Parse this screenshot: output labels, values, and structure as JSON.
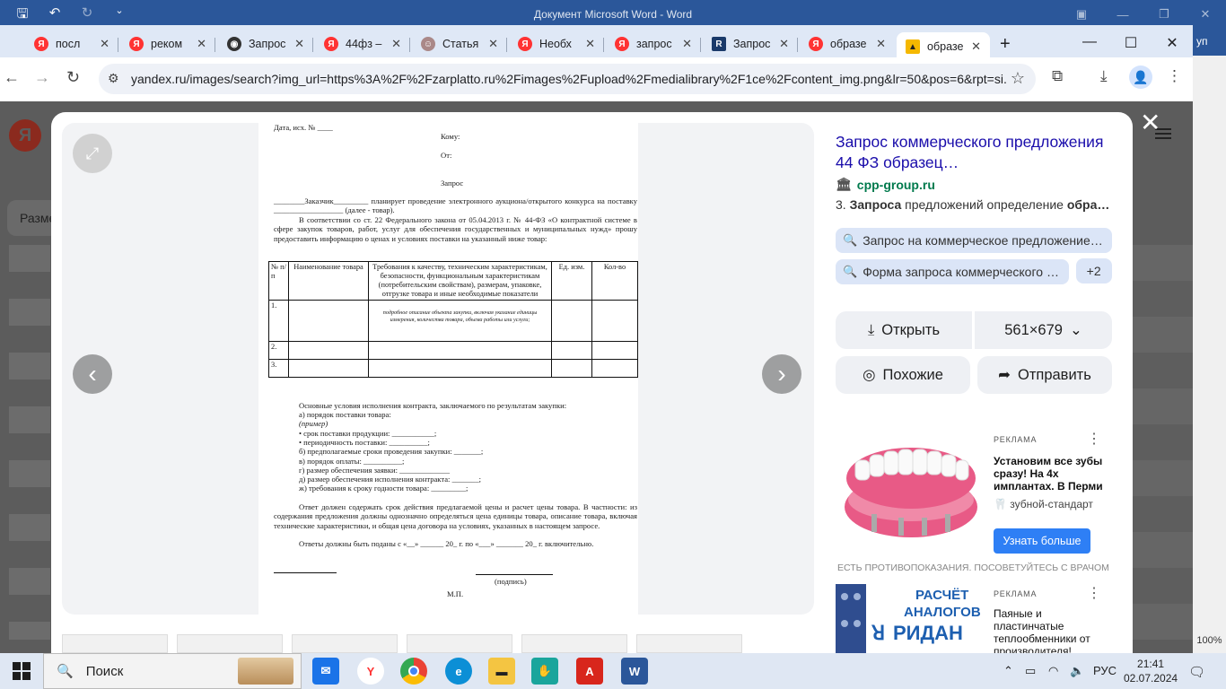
{
  "word": {
    "title": "Документ Microsoft Word - Word",
    "edge_label": "уп"
  },
  "browser": {
    "tabs": [
      {
        "label": "посл",
        "favicon": "yandex-icon",
        "color": "#f33"
      },
      {
        "label": "реком",
        "favicon": "yandex-icon",
        "color": "#f33"
      },
      {
        "label": "Запрос",
        "favicon": "globe-icon",
        "color": "#333"
      },
      {
        "label": "44фз –",
        "favicon": "yandex-icon",
        "color": "#f33"
      },
      {
        "label": "Статья",
        "favicon": "avatar-icon",
        "color": "#a88"
      },
      {
        "label": "Необх",
        "favicon": "yandex-icon",
        "color": "#f33"
      },
      {
        "label": "запрос",
        "favicon": "yandex-icon",
        "color": "#f33"
      },
      {
        "label": "Запрос",
        "favicon": "r-icon",
        "color": "#1a3a6a"
      },
      {
        "label": "образе",
        "favicon": "yandex-icon",
        "color": "#f33"
      },
      {
        "label": "образе",
        "favicon": "image-icon",
        "color": "#f5b800",
        "active": true
      }
    ],
    "url": "yandex.ru/images/search?img_url=https%3A%2F%2Fzarplatto.ru%2Fimages%2Fupload%2Fmedialibrary%2F1ce%2Fcontent_img.png&lr=50&pos=6&rpt=si..."
  },
  "background": {
    "logo": "Я",
    "filter_label": "Разме"
  },
  "document": {
    "date_line": "Дата, исх. № ____",
    "to": "Кому:",
    "from": "От:",
    "heading": "Запрос",
    "p1": "________Заказчик_________ планирует проведение электронного аукциона/открытого конкурса на поставку __________________ (далее - товар).",
    "p2": "В соответствии со ст. 22 Федерального закона от 05.04.2013 г. № 44-ФЗ «О контрактной системе в сфере закупок товаров, работ, услуг для обеспечения государственных и муниципальных нужд» прошу предоставить информацию о ценах и условиях поставки на указанный ниже товар:",
    "table_headers": [
      "№ п/п",
      "Наименование товара",
      "Требования к качеству, техническим характеристикам, безопасности, функциональным характеристикам (потребительским свойствам), размерам, упаковке, отгрузке товара и иные необходимые показатели",
      "Ед. изм.",
      "Кол-во"
    ],
    "table_rows": [
      {
        "n": "1.",
        "desc": "подробное описание объекта закупки, включая указание единицы измерения, количества товара, объема работы или услуги;"
      },
      {
        "n": "2.",
        "desc": ""
      },
      {
        "n": "3.",
        "desc": ""
      }
    ],
    "conditions_title": "Основные условия исполнения контракта, заключаемого по результатам закупки:",
    "conditions": [
      "а) порядок поставки товара:",
      "(пример)",
      "•   срок поставки продукции: ___________;",
      "•   периодичность поставки: __________;",
      "б) предполагаемые сроки проведения закупки: _______;",
      "в) порядок оплаты: __________;",
      "г) размер обеспечения заявки: _____________",
      "д) размер обеспечения исполнения контракта: _______;",
      "ж) требования к сроку годности товара: _________;"
    ],
    "p3": "Ответ должен содержать срок действия предлагаемой цены и расчет цены товара. В частности: из содержания предложения должны однозначно определяться цена единицы товара, описание товара, включая технические характеристики, и общая цена договора на условиях, указанных в настоящем запросе.",
    "p4": "Ответы должны быть поданы с «__» ______ 20_ г. по «___» _______ 20_ г. включительно.",
    "signature": "(подпись)",
    "stamp": "М.П."
  },
  "panel": {
    "title": "Запрос коммерческого предложения 44 ФЗ образец…",
    "source": "cpp-group.ru",
    "snippet_num": "3.",
    "snippet_b1": "Запроса",
    "snippet_mid": " предложений определение ",
    "snippet_b2": "обра…",
    "chips": [
      "Запрос на коммерческое предложение…",
      "Форма запроса коммерческого …",
      "+2"
    ],
    "open_label": "Открыть",
    "size_label": "561×679",
    "similar_label": "Похожие",
    "share_label": "Отправить"
  },
  "ads": [
    {
      "label": "РЕКЛАМА",
      "headline": "Установим все зубы сразу! На 4х имплантах. В Перми",
      "site": "зубной-стандарт",
      "cta": "Узнать больше",
      "warning": "ЕСТЬ ПРОТИВОПОКАЗАНИЯ. ПОСОВЕТУЙТЕСЬ С ВРАЧОМ"
    },
    {
      "label": "РЕКЛАМА",
      "headline": "Паяные и пластинчатые теплообменники от производителя!",
      "img_text1": "РАСЧЁТ",
      "img_text2": "АНАЛОГОВ",
      "img_text3": "РИДАН"
    }
  ],
  "zoom": "100%",
  "taskbar": {
    "search_label": "Поиск",
    "lang": "РУС",
    "time": "21:41",
    "date": "02.07.2024"
  }
}
